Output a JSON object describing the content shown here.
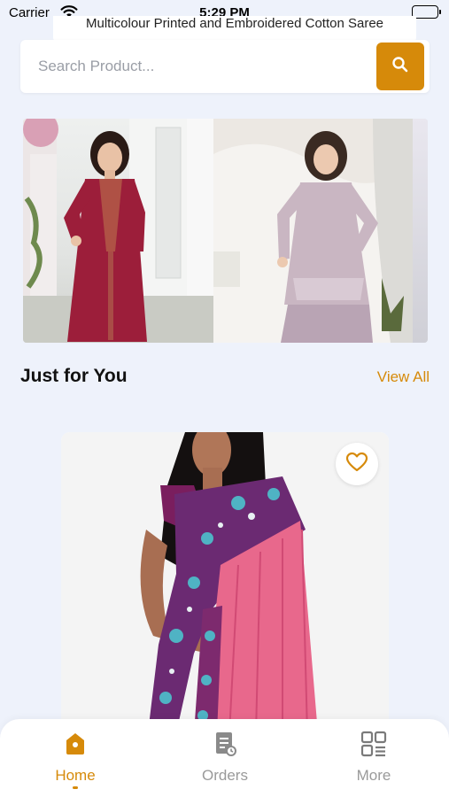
{
  "status_bar": {
    "carrier": "Carrier",
    "time": "5:29 PM"
  },
  "peek_card": {
    "title": "Multicolour Printed and Embroidered Cotton Saree"
  },
  "search": {
    "placeholder": "Search Product..."
  },
  "section": {
    "title": "Just for You",
    "view_all": "View All"
  },
  "tabbar": {
    "items": [
      {
        "label": "Home",
        "icon": "home-icon",
        "active": true
      },
      {
        "label": "Orders",
        "icon": "orders-icon",
        "active": false
      },
      {
        "label": "More",
        "icon": "grid-icon",
        "active": false
      }
    ]
  },
  "colors": {
    "accent": "#d68a0a",
    "background": "#eef2fb"
  }
}
